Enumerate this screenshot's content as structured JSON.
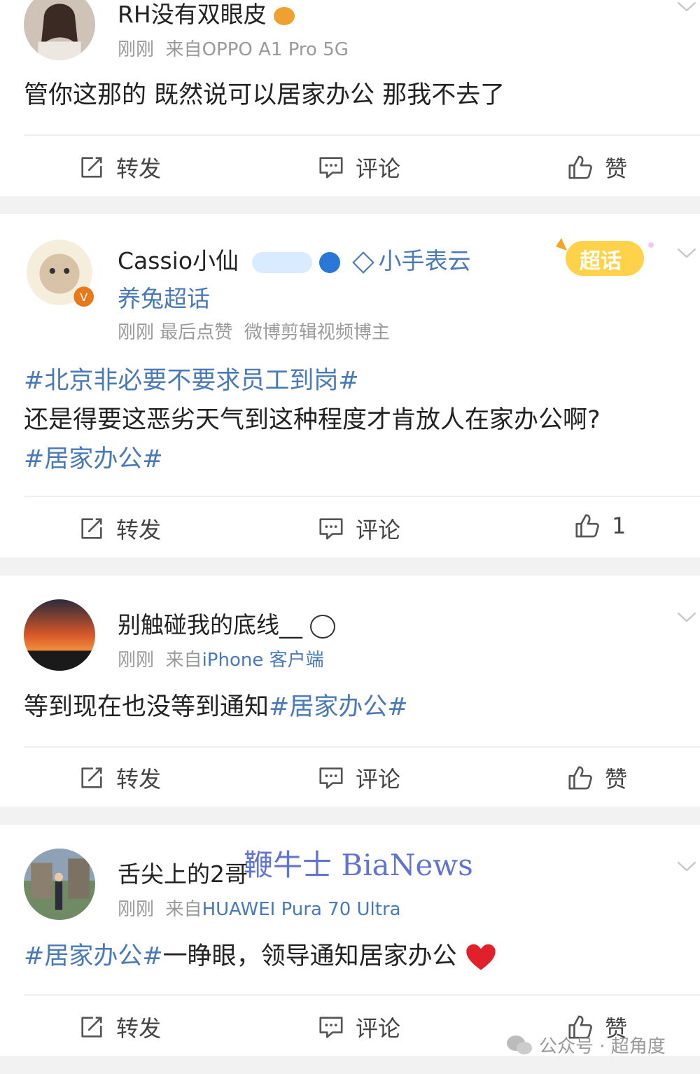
{
  "actions": {
    "repost": "转发",
    "comment": "评论",
    "like": "赞"
  },
  "posts": [
    {
      "username": "RH没有双眼皮",
      "time": "刚刚",
      "source_prefix": "来自",
      "source": "OPPO A1 Pro 5G",
      "content": "管你这那的 既然说可以居家办公 那我不去了"
    },
    {
      "username": "Cassio小仙",
      "topic": "小手表云",
      "super_topic": "养兔超话",
      "badge": "超话",
      "time": "刚刚",
      "activity": "最后点赞",
      "identity": "微博剪辑视频博主",
      "tag1": "#北京非必要不要求员工到岗#",
      "content": "还是得要这恶劣天气到这种程度才肯放人在家办公啊?",
      "tag2": "#居家办公#",
      "like_count": "1"
    },
    {
      "username": "别触碰我的底线__",
      "time": "刚刚",
      "source_prefix": "来自",
      "source": "iPhone 客户端",
      "content": "等到现在也没等到通知",
      "tag": "#居家办公#"
    },
    {
      "username": "舌尖上的2哥",
      "time": "刚刚",
      "source_prefix": "来自",
      "source": "HUAWEI Pura 70 Ultra",
      "tag": "#居家办公#",
      "content": "一睁眼，领导通知居家办公"
    }
  ],
  "watermark": "鞭牛士 BiaNews",
  "wechat_label": "公众号 · 超角度",
  "colors": {
    "link": "#4a79b7",
    "meta": "#9a9a9a",
    "separator": "#f2f2f2"
  }
}
